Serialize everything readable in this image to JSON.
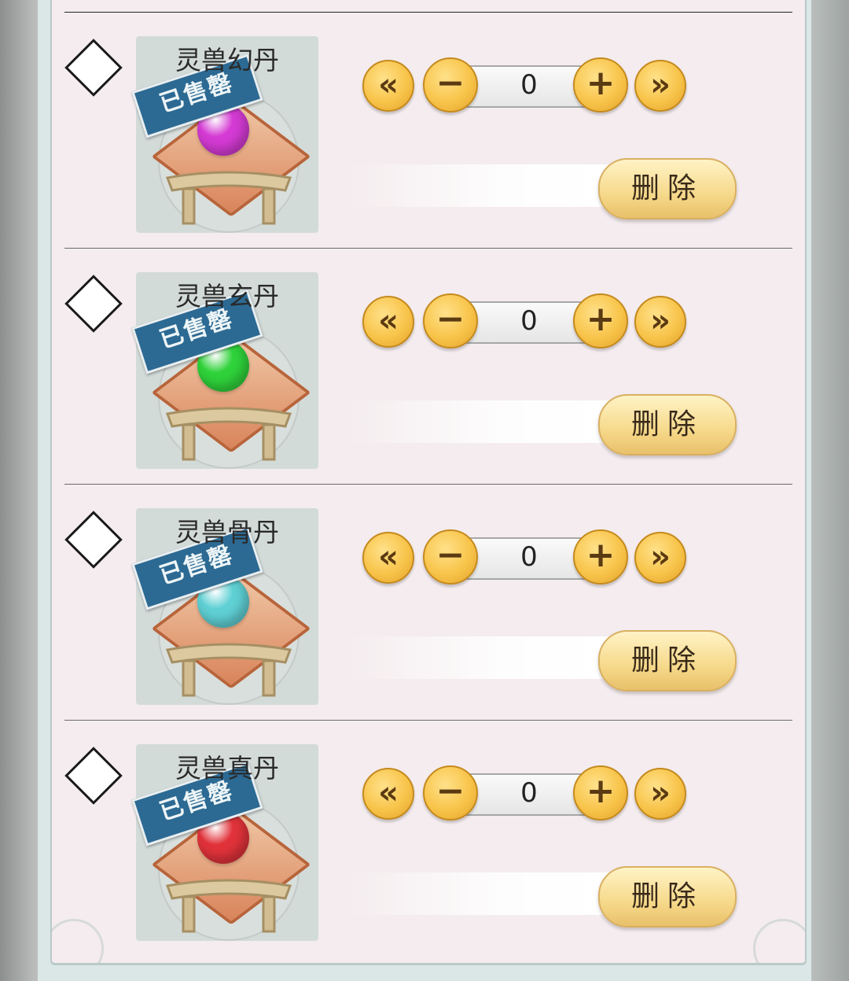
{
  "colors": {
    "panel_bg": "#f4ecee",
    "button_gold": "#f8c44a",
    "stamp_blue": "#2c6a93"
  },
  "items": [
    {
      "name": "灵兽幻丹",
      "stamp": "已售罄",
      "orb_color": "#d43ad4",
      "quantity": "0",
      "first_icon": "«",
      "minus_icon": "−",
      "plus_icon": "+",
      "last_icon": "»",
      "delete_label": "删除"
    },
    {
      "name": "灵兽玄丹",
      "stamp": "已售罄",
      "orb_color": "#2fd23a",
      "quantity": "0",
      "first_icon": "«",
      "minus_icon": "−",
      "plus_icon": "+",
      "last_icon": "»",
      "delete_label": "删除"
    },
    {
      "name": "灵兽骨丹",
      "stamp": "已售罄",
      "orb_color": "#5fd0d4",
      "quantity": "0",
      "first_icon": "«",
      "minus_icon": "−",
      "plus_icon": "+",
      "last_icon": "»",
      "delete_label": "删除"
    },
    {
      "name": "灵兽真丹",
      "stamp": "已售罄",
      "orb_color": "#e1323a",
      "quantity": "0",
      "first_icon": "«",
      "minus_icon": "−",
      "plus_icon": "+",
      "last_icon": "»",
      "delete_label": "删除"
    }
  ]
}
